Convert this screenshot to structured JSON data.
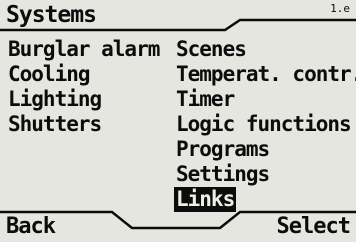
{
  "header": {
    "title": "Systems",
    "version": "1.e"
  },
  "menu": {
    "left_column": [
      {
        "label": "Burglar alarm"
      },
      {
        "label": "Cooling"
      },
      {
        "label": "Lighting"
      },
      {
        "label": "Shutters"
      }
    ],
    "right_column": [
      {
        "label": "Scenes"
      },
      {
        "label": "Temperat. contr."
      },
      {
        "label": "Timer"
      },
      {
        "label": "Logic functions"
      },
      {
        "label": "Programs"
      },
      {
        "label": "Settings"
      },
      {
        "label": "Links",
        "selected": true
      }
    ]
  },
  "softkeys": {
    "left": "Back",
    "right": "Select"
  },
  "colors": {
    "background": "#e6e6e0",
    "foreground": "#0c0c0c",
    "selection_text": "#eeeee8"
  }
}
